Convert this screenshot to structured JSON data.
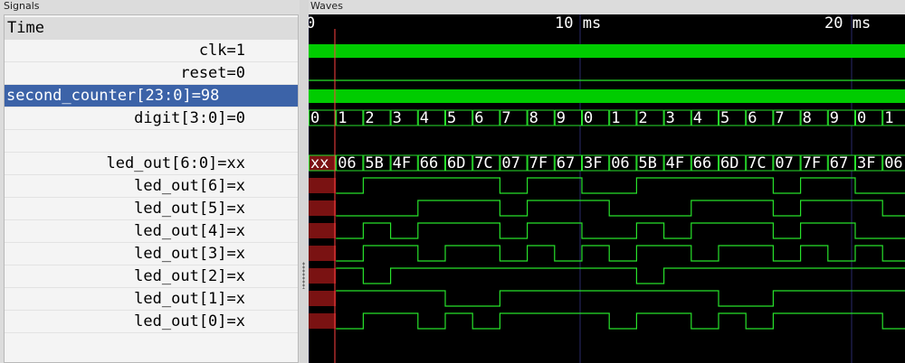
{
  "panels": {
    "signals_title": "Signals",
    "waves_title": "Waves"
  },
  "timeline": {
    "labels": [
      "0",
      "10 ms",
      "20 ms"
    ]
  },
  "signals": [
    {
      "label": "Time",
      "kind": "header"
    },
    {
      "label": "clk=1",
      "kind": "clock"
    },
    {
      "label": "reset=0",
      "kind": "low"
    },
    {
      "label": "second_counter[23:0]=98",
      "kind": "dense",
      "selected": true
    },
    {
      "label": "digit[3:0]=0",
      "kind": "bus",
      "values": [
        "0",
        "1",
        "2",
        "3",
        "4",
        "5",
        "6",
        "7",
        "8",
        "9",
        "0",
        "1",
        "2",
        "3",
        "4",
        "5",
        "6",
        "7",
        "8",
        "9",
        "0",
        "1"
      ]
    },
    {
      "label": "",
      "kind": "blank"
    },
    {
      "label": "led_out[6:0]=xx",
      "kind": "bus",
      "values": [
        "xx",
        "06",
        "5B",
        "4F",
        "66",
        "6D",
        "7C",
        "07",
        "7F",
        "67",
        "3F",
        "06",
        "5B",
        "4F",
        "66",
        "6D",
        "7C",
        "07",
        "7F",
        "67",
        "3F",
        "06"
      ]
    },
    {
      "label": "led_out[6]=x",
      "kind": "bit",
      "bits": [
        0,
        0,
        1,
        1,
        1,
        1,
        1,
        0,
        1,
        1,
        0,
        0,
        1,
        1,
        1,
        1,
        1,
        0,
        1,
        1,
        0,
        0
      ]
    },
    {
      "label": "led_out[5]=x",
      "kind": "bit",
      "bits": [
        0,
        0,
        0,
        0,
        1,
        1,
        1,
        0,
        1,
        1,
        1,
        0,
        0,
        0,
        1,
        1,
        1,
        0,
        1,
        1,
        1,
        0
      ]
    },
    {
      "label": "led_out[4]=x",
      "kind": "bit",
      "bits": [
        0,
        0,
        1,
        0,
        1,
        1,
        1,
        0,
        1,
        1,
        0,
        0,
        1,
        0,
        1,
        1,
        1,
        0,
        1,
        1,
        0,
        0
      ]
    },
    {
      "label": "led_out[3]=x",
      "kind": "bit",
      "bits": [
        0,
        0,
        1,
        1,
        0,
        1,
        1,
        0,
        1,
        0,
        1,
        0,
        1,
        1,
        0,
        1,
        1,
        0,
        1,
        0,
        1,
        0
      ]
    },
    {
      "label": "led_out[2]=x",
      "kind": "bit",
      "bits": [
        0,
        1,
        0,
        1,
        1,
        1,
        1,
        1,
        1,
        1,
        1,
        1,
        0,
        1,
        1,
        1,
        1,
        1,
        1,
        1,
        1,
        1
      ]
    },
    {
      "label": "led_out[1]=x",
      "kind": "bit",
      "bits": [
        0,
        1,
        1,
        1,
        1,
        0,
        0,
        1,
        1,
        1,
        1,
        1,
        1,
        1,
        1,
        0,
        0,
        1,
        1,
        1,
        1,
        1
      ]
    },
    {
      "label": "led_out[0]=x",
      "kind": "bit",
      "bits": [
        0,
        0,
        1,
        1,
        0,
        1,
        0,
        1,
        1,
        1,
        1,
        0,
        1,
        1,
        0,
        1,
        0,
        1,
        1,
        1,
        1,
        0
      ]
    }
  ],
  "colors": {
    "wave": "#27e12b",
    "wave_fill": "#00cc00",
    "bus_fill": "#000000",
    "unknown": "#7a1212",
    "marker": "#ff4040",
    "grid": "#2a2a6a",
    "text": "#ffffff",
    "selection": "#3c63a8"
  }
}
